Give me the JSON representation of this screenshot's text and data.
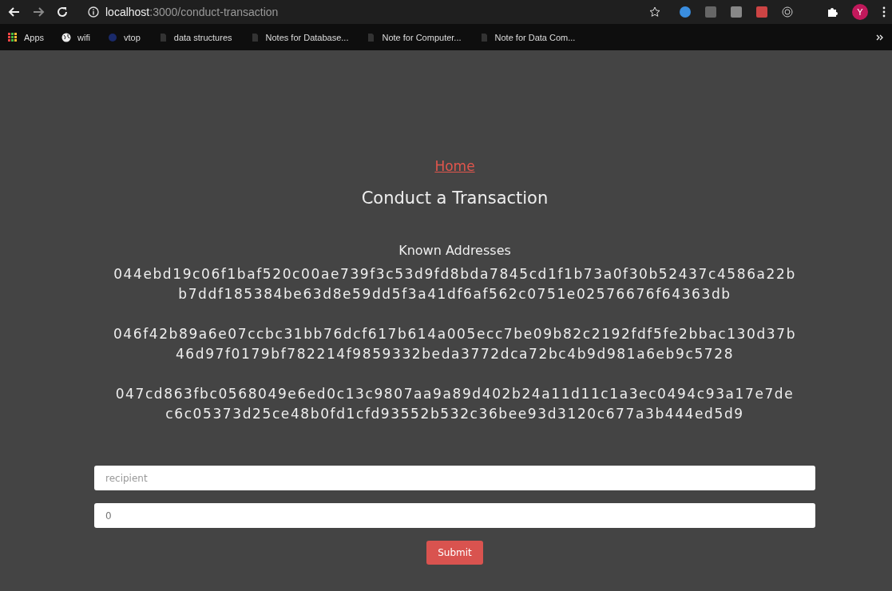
{
  "browser": {
    "url_host": "localhost",
    "url_path": ":3000/conduct-transaction",
    "bookmarks": [
      {
        "label": "Apps",
        "kind": "apps"
      },
      {
        "label": "wifi",
        "kind": "globe"
      },
      {
        "label": "vtop",
        "kind": "dot"
      },
      {
        "label": "data structures",
        "kind": "page"
      },
      {
        "label": "Notes for Database...",
        "kind": "page"
      },
      {
        "label": "Note for Computer...",
        "kind": "page"
      },
      {
        "label": "Note for Data Com...",
        "kind": "page"
      }
    ],
    "profile": "Y"
  },
  "page": {
    "home_link": "Home",
    "title": "Conduct a Transaction",
    "addresses_heading": "Known Addresses",
    "addresses": [
      "044ebd19c06f1baf520c00ae739f3c53d9fd8bda7845cd1f1b73a0f30b52437c4586a22bb7ddf185384be63d8e59dd5f3a41df6af562c0751e02576676f64363db",
      "046f42b89a6e07ccbc31bb76dcf617b614a005ecc7be09b82c2192fdf5fe2bbac130d37b46d97f0179bf782214f9859332beda3772dca72bc4b9d981a6eb9c5728",
      "047cd863fbc0568049e6ed0c13c9807aa9a89d402b24a11d11c1a3ec0494c93a17e7dec6c05373d25ce48b0fd1cfd93552b532c36bee93d3120c677a3b444ed5d9"
    ],
    "recipient": {
      "placeholder": "recipient"
    },
    "amount": {
      "value": "0"
    },
    "submit": "Submit"
  }
}
